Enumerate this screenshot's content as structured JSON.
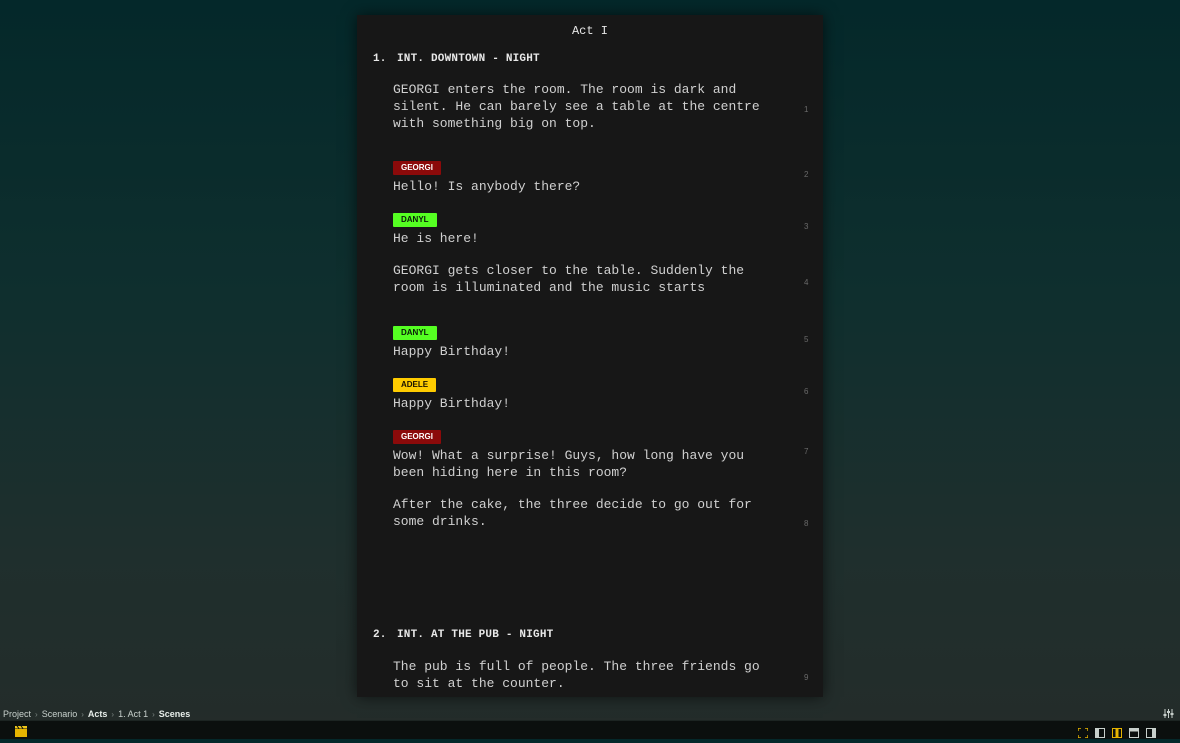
{
  "act_title": "Act I",
  "scenes": [
    {
      "number": "1.",
      "heading": "INT. DOWNTOWN - NIGHT"
    },
    {
      "number": "2.",
      "heading": "INT. AT THE PUB - NIGHT"
    }
  ],
  "lines": [
    {
      "text": "GEORGI enters the room. The room is dark and\nsilent. He can barely see a table at the centre\nwith something big on top.",
      "line_number": "1"
    },
    {
      "character": "GEORGI",
      "text": "Hello! Is anybody there?",
      "line_number": "2"
    },
    {
      "character": "DANYL",
      "text": "He is here!",
      "line_number": "3"
    },
    {
      "text": "GEORGI gets closer to the table. Suddenly the\nroom is illuminated and the music starts",
      "line_number": "4"
    },
    {
      "character": "DANYL",
      "text": "Happy Birthday!",
      "line_number": "5"
    },
    {
      "character": "ADELE",
      "text": "Happy Birthday!",
      "line_number": "6"
    },
    {
      "character": "GEORGI",
      "text": "Wow! What a surprise! Guys, how long have you\nbeen hiding here in this room?",
      "line_number": "7"
    },
    {
      "text": "After the cake, the three decide to go out for\nsome drinks.",
      "line_number": "8"
    },
    {
      "text": "The pub is full of people. The three friends go\nto sit at the counter.",
      "line_number": "9"
    }
  ],
  "character_colors": {
    "GEORGI": "#8b0a0a",
    "DANYL": "#55ff22",
    "ADELE": "#ffcc00"
  },
  "breadcrumb": [
    "Project",
    "Scenario",
    "Acts",
    "1. Act 1",
    "Scenes"
  ],
  "statusbar": {
    "left_icon": "clapperboard-icon",
    "right_icons": [
      "fullscreen-icon",
      "left-panel-icon",
      "center-panel-icon",
      "top-panel-icon",
      "right-panel-icon"
    ],
    "settings_icon": "sliders-icon"
  }
}
